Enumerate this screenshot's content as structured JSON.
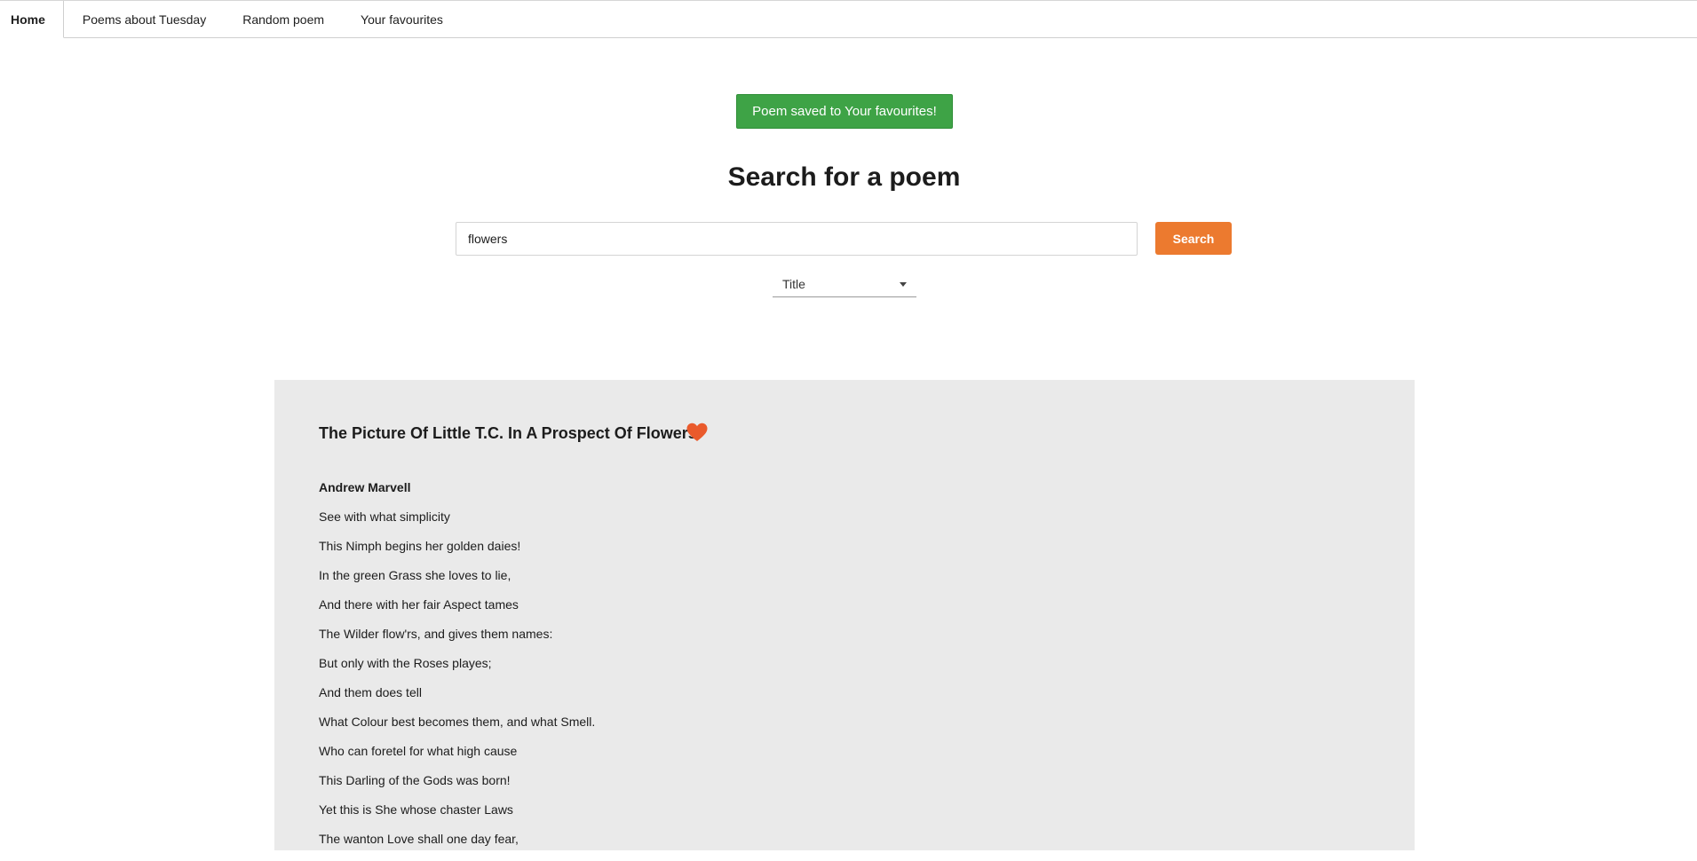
{
  "nav": {
    "tabs": [
      {
        "label": "Home",
        "active": true
      },
      {
        "label": "Poems about Tuesday",
        "active": false
      },
      {
        "label": "Random poem",
        "active": false
      },
      {
        "label": "Your favourites",
        "active": false
      }
    ]
  },
  "toast": {
    "text": "Poem saved to Your favourites!",
    "color": "#3ea346"
  },
  "search": {
    "heading": "Search for a poem",
    "query": "flowers",
    "button_label": "Search",
    "button_color": "#ec7a2f",
    "field": {
      "selected": "Title"
    }
  },
  "poem": {
    "title": "The Picture Of Little T.C. In A Prospect Of Flowers",
    "favourite": true,
    "heart_color": "#ea5a2c",
    "author": "Andrew Marvell",
    "lines": [
      "See with what simplicity",
      "This Nimph begins her golden daies!",
      "In the green Grass she loves to lie,",
      "And there with her fair Aspect tames",
      "The Wilder flow'rs, and gives them names:",
      "But only with the Roses playes;",
      "And them does tell",
      "What Colour best becomes them, and what Smell.",
      "Who can foretel for what high cause",
      "This Darling of the Gods was born!",
      "Yet this is She whose chaster Laws",
      "The wanton Love shall one day fear,"
    ]
  }
}
